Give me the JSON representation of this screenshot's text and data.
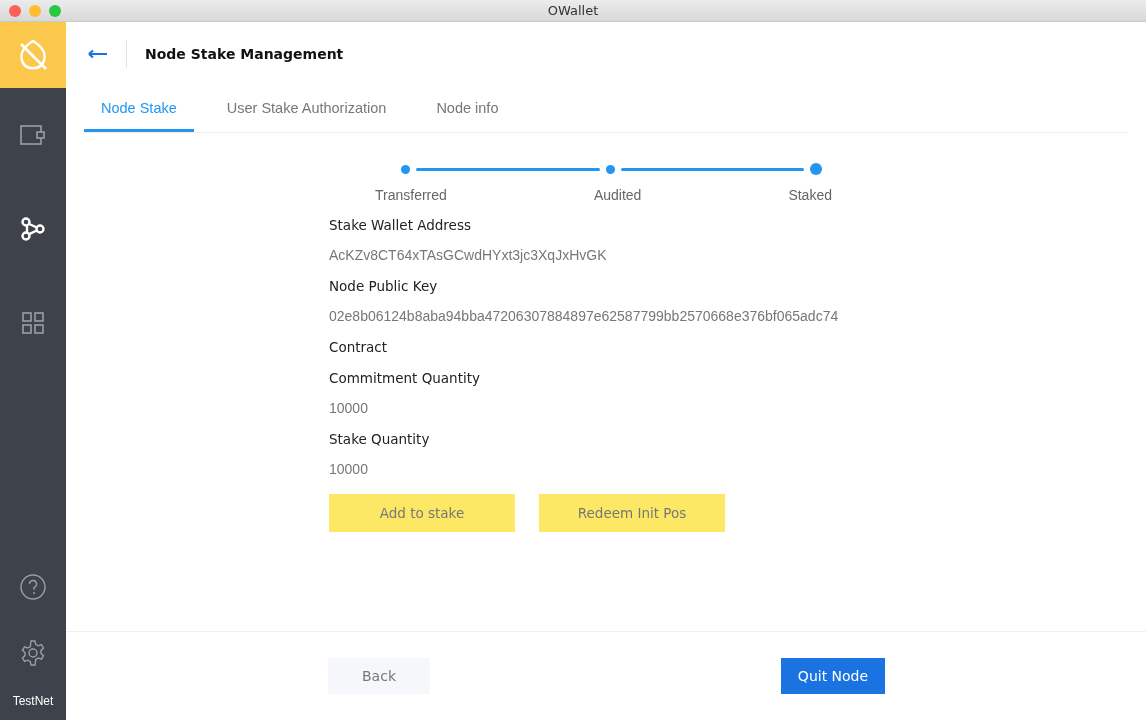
{
  "window": {
    "title": "OWallet"
  },
  "sidebar": {
    "items": [
      {
        "kind": "wallet",
        "selected": false
      },
      {
        "kind": "node",
        "selected": true
      },
      {
        "kind": "apps",
        "selected": false
      }
    ],
    "bottom_items": [
      {
        "kind": "help",
        "selected": false
      },
      {
        "kind": "settings",
        "selected": false
      }
    ],
    "network": "TestNet"
  },
  "header": {
    "title": "Node Stake Management"
  },
  "tabs": [
    {
      "label": "Node Stake",
      "selected": true
    },
    {
      "label": "User Stake Authorization",
      "selected": false
    },
    {
      "label": "Node info",
      "selected": false
    }
  ],
  "steps": [
    {
      "label": "Transferred",
      "current": false
    },
    {
      "label": "Audited",
      "current": false
    },
    {
      "label": "Staked",
      "current": true
    }
  ],
  "fields": [
    {
      "label": "Stake Wallet Address",
      "value": "AcKZv8CT64xTAsGCwdHYxt3jc3XqJxHvGK"
    },
    {
      "label": "Node Public Key",
      "value": "02e8b06124b8aba94bba47206307884897e62587799bb2570668e376bf065adc74"
    },
    {
      "label": "Contract"
    },
    {
      "label": "Commitment Quantity",
      "value": "10000"
    },
    {
      "label": "Stake Quantity",
      "value": "10000"
    }
  ],
  "actions": [
    "Add to stake",
    "Redeem Init Pos"
  ],
  "footer": {
    "back": "Back",
    "primary": "Quit Node"
  }
}
